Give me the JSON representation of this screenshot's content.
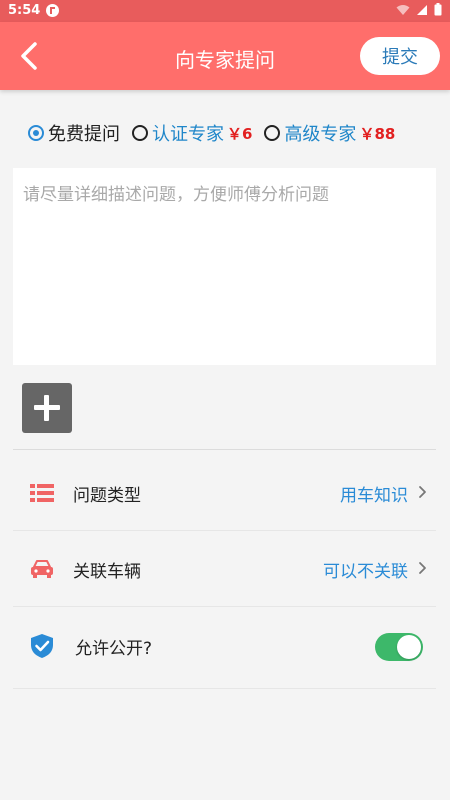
{
  "statusbar": {
    "time": "5:54",
    "icons": [
      "app-badge-icon",
      "wifi-icon",
      "signal-icon",
      "battery-icon"
    ]
  },
  "header": {
    "title": "向专家提问",
    "submit_label": "提交",
    "back_icon": "chevron-left-icon",
    "bg_color": "#ff6e6b"
  },
  "question_type": {
    "options": [
      {
        "label": "免费提问",
        "price": "",
        "selected": true
      },
      {
        "label": "认证专家",
        "price": "￥6",
        "selected": false
      },
      {
        "label": "高级专家",
        "price": "￥88",
        "selected": false
      }
    ]
  },
  "question": {
    "value": "",
    "placeholder": "请尽量详细描述问题，方便师傅分析问题"
  },
  "rows": {
    "category": {
      "label": "问题类型",
      "value": "用车知识",
      "icon": "list-icon"
    },
    "vehicle": {
      "label": "关联车辆",
      "value": "可以不关联",
      "icon": "car-icon"
    },
    "public": {
      "label": "允许公开?",
      "enabled": true,
      "icon": "shield-check-icon"
    }
  },
  "colors": {
    "accent_blue": "#2a8bd6",
    "price_red": "#e22020",
    "toggle_on": "#3db86a"
  }
}
